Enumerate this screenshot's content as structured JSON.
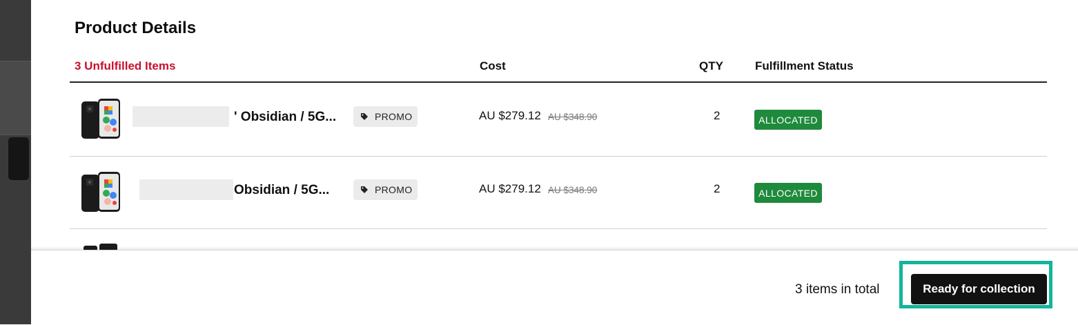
{
  "panel": {
    "title": "Product Details"
  },
  "table": {
    "headers": {
      "items": "3 Unfulfilled Items",
      "cost": "Cost",
      "qty": "QTY",
      "status": "Fulfillment Status"
    },
    "rows": [
      {
        "name": "' Obsidian / 5G...",
        "badge": "PROMO",
        "price": "AU $279.12",
        "original_price": "AU $348.90",
        "qty": "2",
        "status": "ALLOCATED"
      },
      {
        "name": "Obsidian / 5G...",
        "badge": "PROMO",
        "price": "AU $279.12",
        "original_price": "AU $348.90",
        "qty": "2",
        "status": "ALLOCATED"
      }
    ]
  },
  "footer": {
    "total": "3 items in total",
    "primary_button": "Ready for collection"
  },
  "colors": {
    "accent_red": "#c8102e",
    "status_green": "#1e8a3c",
    "highlight_teal": "#12b59a",
    "button_dark": "#111111"
  },
  "icons": {
    "badge_icon": "tag-icon",
    "product_image": "phone-image"
  }
}
